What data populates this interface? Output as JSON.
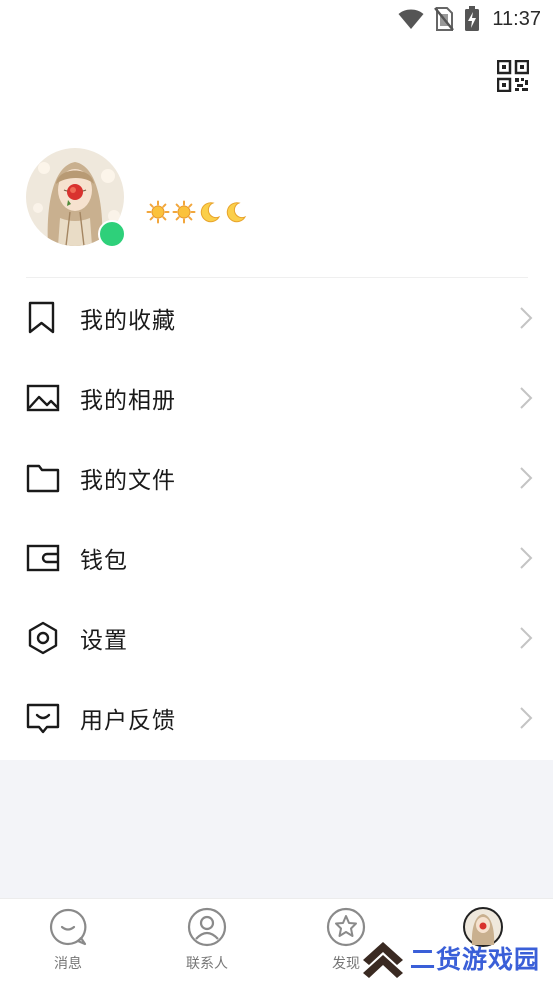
{
  "status_bar": {
    "time": "11:37",
    "icons": [
      "wifi-icon",
      "no-sim-icon",
      "battery-charging-icon"
    ]
  },
  "header": {
    "qr_icon": "qr-code-icon"
  },
  "profile": {
    "online": true,
    "online_color": "#2ed07a",
    "level_icons": [
      "sun-icon",
      "sun-icon",
      "moon-icon",
      "moon-icon"
    ]
  },
  "menu": {
    "items": [
      {
        "label": "我的收藏",
        "icon": "bookmark-icon"
      },
      {
        "label": "我的相册",
        "icon": "image-icon"
      },
      {
        "label": "我的文件",
        "icon": "folder-icon"
      },
      {
        "label": "钱包",
        "icon": "wallet-icon"
      },
      {
        "label": "设置",
        "icon": "settings-hexagon-icon"
      },
      {
        "label": "用户反馈",
        "icon": "feedback-icon"
      }
    ]
  },
  "tab_bar": {
    "tabs": [
      {
        "label": "消息",
        "icon": "message-icon"
      },
      {
        "label": "联系人",
        "icon": "contacts-icon"
      },
      {
        "label": "发现",
        "icon": "discover-star-icon"
      },
      {
        "label": "",
        "icon": "avatar-icon"
      }
    ]
  },
  "watermark": {
    "text": "二货游戏园",
    "color": "#3a5fd8"
  }
}
